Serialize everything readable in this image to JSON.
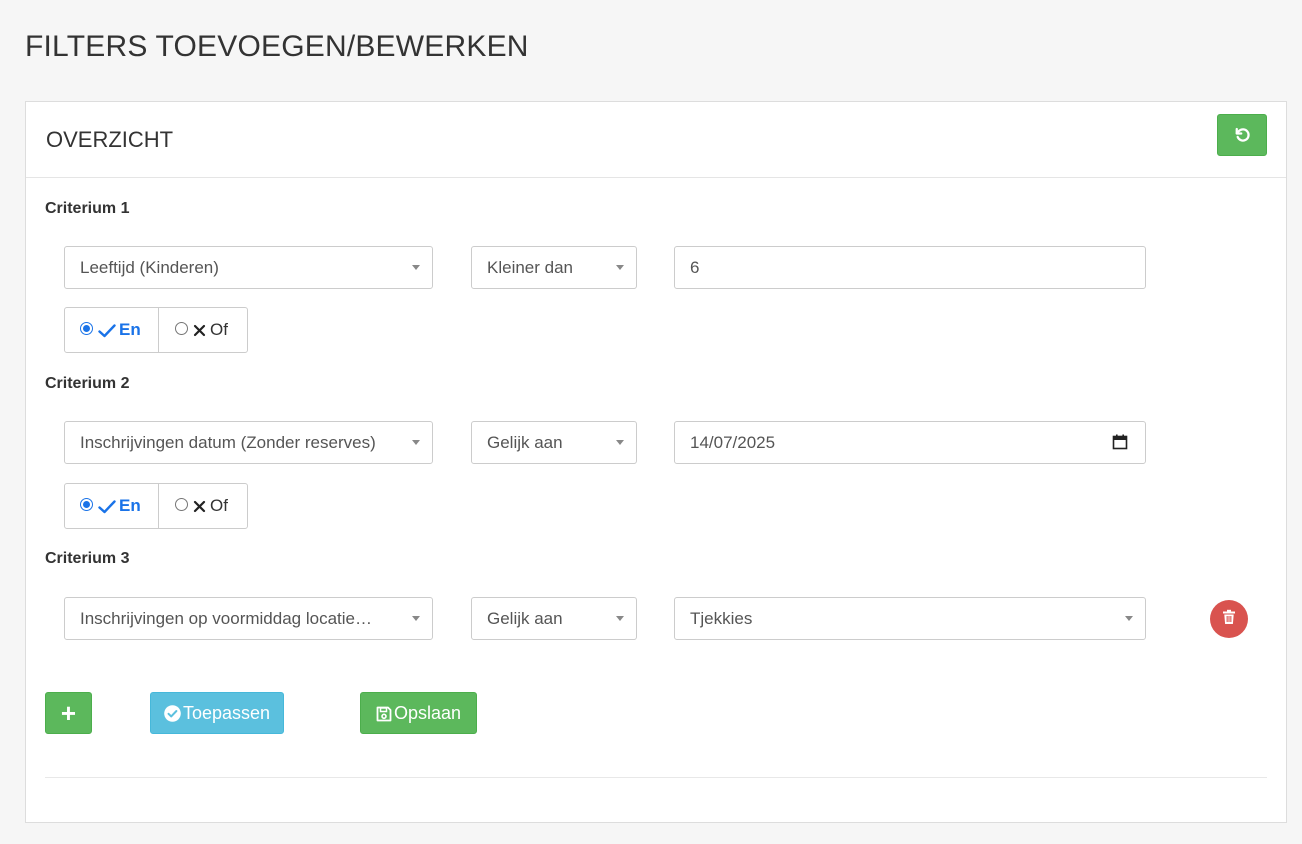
{
  "page_title": "FILTERS TOEVOEGEN/BEWERKEN",
  "panel": {
    "title": "OVERZICHT",
    "reset_icon": "undo-icon"
  },
  "criteria": [
    {
      "label": "Criterium 1",
      "field": "Leeftijd (Kinderen)",
      "operator": "Kleiner dan",
      "value": "6",
      "value_type": "text",
      "logic": {
        "and_label": "En",
        "or_label": "Of",
        "selected": "En"
      }
    },
    {
      "label": "Criterium 2",
      "field": "Inschrijvingen datum (Zonder reserves)",
      "operator": "Gelijk aan",
      "value": "14/07/2025",
      "value_type": "date",
      "logic": {
        "and_label": "En",
        "or_label": "Of",
        "selected": "En"
      }
    },
    {
      "label": "Criterium 3",
      "field": "Inschrijvingen op voormiddag locatie…",
      "operator": "Gelijk aan",
      "value": "Tjekkies",
      "value_type": "select"
    }
  ],
  "actions": {
    "add_label": "+",
    "apply_label": "Toepassen",
    "save_label": "Opslaan"
  },
  "colors": {
    "success": "#5cb85c",
    "info": "#5bc0de",
    "danger": "#d9534f",
    "radio_selected": "#1a73e8"
  }
}
